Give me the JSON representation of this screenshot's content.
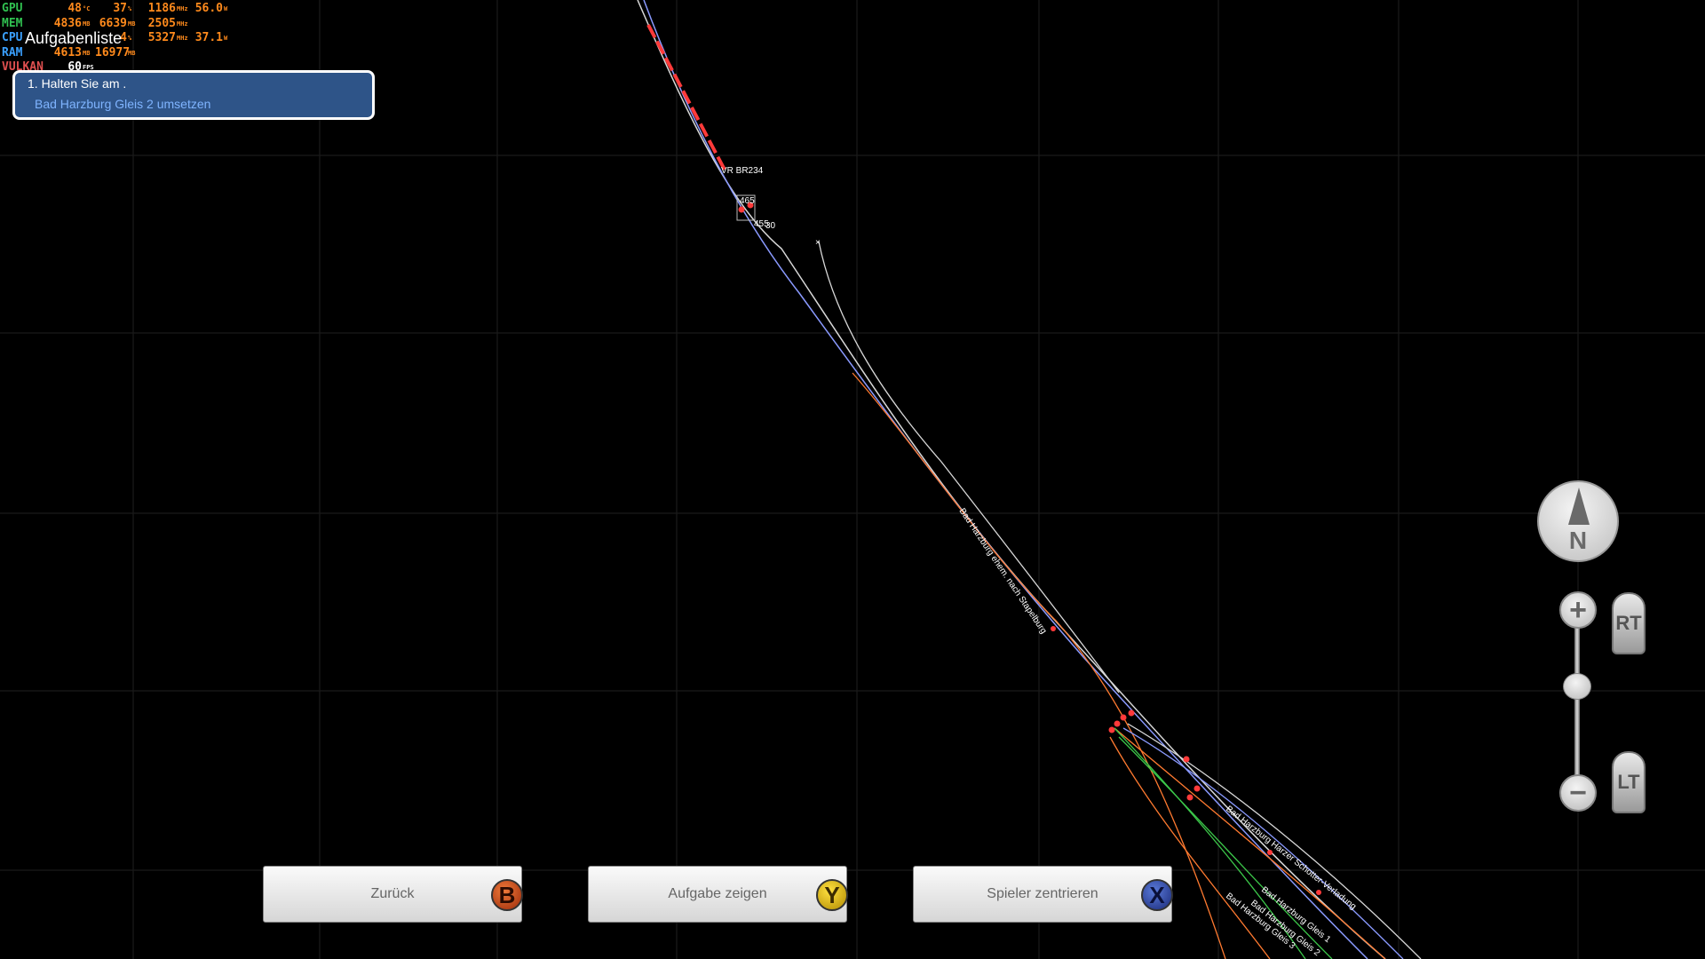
{
  "perf": {
    "gpu": {
      "label": "GPU",
      "temp": "48",
      "temp_unit": "°C",
      "load": "37",
      "load_unit": "%",
      "clock": "1186",
      "clock_unit": "MHz",
      "power": "56.0",
      "power_unit": "W"
    },
    "mem": {
      "label": "MEM",
      "used": "4836",
      "used_unit": "MB",
      "total": "6639",
      "total_unit": "MB",
      "clock": "2505",
      "clock_unit": "MHz"
    },
    "cpu": {
      "label": "CPU",
      "load": "4",
      "load_unit": "%",
      "clock": "5327",
      "clock_unit": "MHz",
      "power": "37.1",
      "power_unit": "W"
    },
    "ram": {
      "label": "RAM",
      "used": "4613",
      "used_unit": "MB",
      "total": "16977",
      "total_unit": "MB"
    },
    "vulkan": {
      "label": "VULKAN",
      "fps": "60",
      "fps_unit": "FPS"
    }
  },
  "task_list": {
    "title": "Aufgabenliste",
    "step": "1. Halten Sie am .",
    "description": "Bad Harzburg Gleis 2 umsetzen"
  },
  "map": {
    "train_label": "VR BR234",
    "marker_1": "465",
    "marker_2": "455",
    "marker_3": "30",
    "track_labels": [
      "Bad Harzburg ehem. nach Stapelburg",
      "Bad Harzburg Harzer Schotter-Verladung",
      "Bad Harzburg Gleis 1",
      "Bad Harzburg Gleis 2",
      "Bad Harzburg Gleis 3"
    ]
  },
  "buttons": {
    "back": {
      "label": "Zurück",
      "key": "B"
    },
    "show_task": {
      "label": "Aufgabe zeigen",
      "key": "Y"
    },
    "center_player": {
      "label": "Spieler zentrieren",
      "key": "X"
    }
  },
  "controls": {
    "compass_label": "N",
    "zoom_in": "+",
    "zoom_out": "−",
    "rt": "RT",
    "lt": "LT"
  },
  "colors": {
    "panel": "#2e5488",
    "track_white": "#e0e0e0",
    "track_blue": "#8a9aff",
    "track_orange": "#ff7a30",
    "track_green": "#3cc84a",
    "marker_red": "#ff3a3a"
  }
}
